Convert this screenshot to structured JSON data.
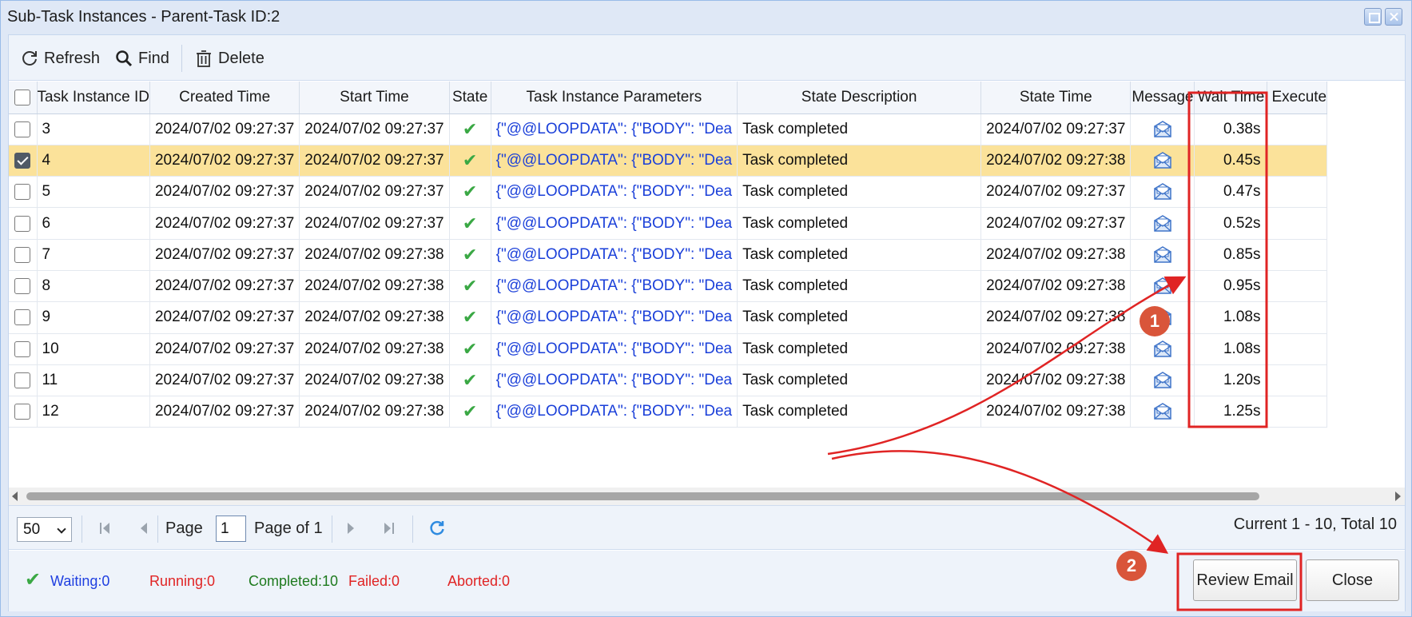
{
  "window": {
    "title": "Sub-Task Instances - Parent-Task ID:2"
  },
  "toolbar": {
    "refresh_label": "Refresh",
    "find_label": "Find",
    "delete_label": "Delete"
  },
  "table": {
    "columns": {
      "id": "Task Instance ID",
      "created": "Created Time",
      "start": "Start Time",
      "state": "State",
      "params": "Task Instance Parameters",
      "state_desc": "State Description",
      "state_time": "State Time",
      "message": "Message",
      "wait": "Wait Time",
      "execute": "Execute"
    },
    "rows": [
      {
        "id": "3",
        "created": "2024/07/02 09:27:37",
        "start": "2024/07/02 09:27:37",
        "params": "{\"@@LOOPDATA\": {\"BODY\": \"Dea",
        "desc": "Task completed",
        "state_time": "2024/07/02 09:27:37",
        "wait": "0.38s",
        "checked": false
      },
      {
        "id": "4",
        "created": "2024/07/02 09:27:37",
        "start": "2024/07/02 09:27:37",
        "params": "{\"@@LOOPDATA\": {\"BODY\": \"Dea",
        "desc": "Task completed",
        "state_time": "2024/07/02 09:27:38",
        "wait": "0.45s",
        "checked": true
      },
      {
        "id": "5",
        "created": "2024/07/02 09:27:37",
        "start": "2024/07/02 09:27:37",
        "params": "{\"@@LOOPDATA\": {\"BODY\": \"Dea",
        "desc": "Task completed",
        "state_time": "2024/07/02 09:27:37",
        "wait": "0.47s",
        "checked": false
      },
      {
        "id": "6",
        "created": "2024/07/02 09:27:37",
        "start": "2024/07/02 09:27:37",
        "params": "{\"@@LOOPDATA\": {\"BODY\": \"Dea",
        "desc": "Task completed",
        "state_time": "2024/07/02 09:27:37",
        "wait": "0.52s",
        "checked": false
      },
      {
        "id": "7",
        "created": "2024/07/02 09:27:37",
        "start": "2024/07/02 09:27:38",
        "params": "{\"@@LOOPDATA\": {\"BODY\": \"Dea",
        "desc": "Task completed",
        "state_time": "2024/07/02 09:27:38",
        "wait": "0.85s",
        "checked": false
      },
      {
        "id": "8",
        "created": "2024/07/02 09:27:37",
        "start": "2024/07/02 09:27:38",
        "params": "{\"@@LOOPDATA\": {\"BODY\": \"Dea",
        "desc": "Task completed",
        "state_time": "2024/07/02 09:27:38",
        "wait": "0.95s",
        "checked": false
      },
      {
        "id": "9",
        "created": "2024/07/02 09:27:37",
        "start": "2024/07/02 09:27:38",
        "params": "{\"@@LOOPDATA\": {\"BODY\": \"Dea",
        "desc": "Task completed",
        "state_time": "2024/07/02 09:27:38",
        "wait": "1.08s",
        "checked": false
      },
      {
        "id": "10",
        "created": "2024/07/02 09:27:37",
        "start": "2024/07/02 09:27:38",
        "params": "{\"@@LOOPDATA\": {\"BODY\": \"Dea",
        "desc": "Task completed",
        "state_time": "2024/07/02 09:27:38",
        "wait": "1.08s",
        "checked": false
      },
      {
        "id": "11",
        "created": "2024/07/02 09:27:37",
        "start": "2024/07/02 09:27:38",
        "params": "{\"@@LOOPDATA\": {\"BODY\": \"Dea",
        "desc": "Task completed",
        "state_time": "2024/07/02 09:27:38",
        "wait": "1.20s",
        "checked": false
      },
      {
        "id": "12",
        "created": "2024/07/02 09:27:37",
        "start": "2024/07/02 09:27:38",
        "params": "{\"@@LOOPDATA\": {\"BODY\": \"Dea",
        "desc": "Task completed",
        "state_time": "2024/07/02 09:27:38",
        "wait": "1.25s",
        "checked": false
      }
    ]
  },
  "pager": {
    "page_size": "50",
    "page_label": "Page",
    "page_value": "1",
    "page_of": "Page of 1",
    "info": "Current 1 - 10, Total 10"
  },
  "status": {
    "waiting": "Waiting:0",
    "running": "Running:0",
    "completed": "Completed:10",
    "failed": "Failed:0",
    "aborted": "Aborted:0"
  },
  "buttons": {
    "review_email": "Review Email",
    "close": "Close"
  },
  "annotations": {
    "badge1": "1",
    "badge2": "2"
  },
  "colors": {
    "selected_row": "#fbe29a",
    "param_text": "#1a3fd9",
    "annotation_red": "#e02424",
    "badge": "#d9553a",
    "waiting": "#1f3fe0",
    "running": "#e02424",
    "completed": "#1e7a1e",
    "failed": "#e02424",
    "aborted": "#e02424"
  }
}
